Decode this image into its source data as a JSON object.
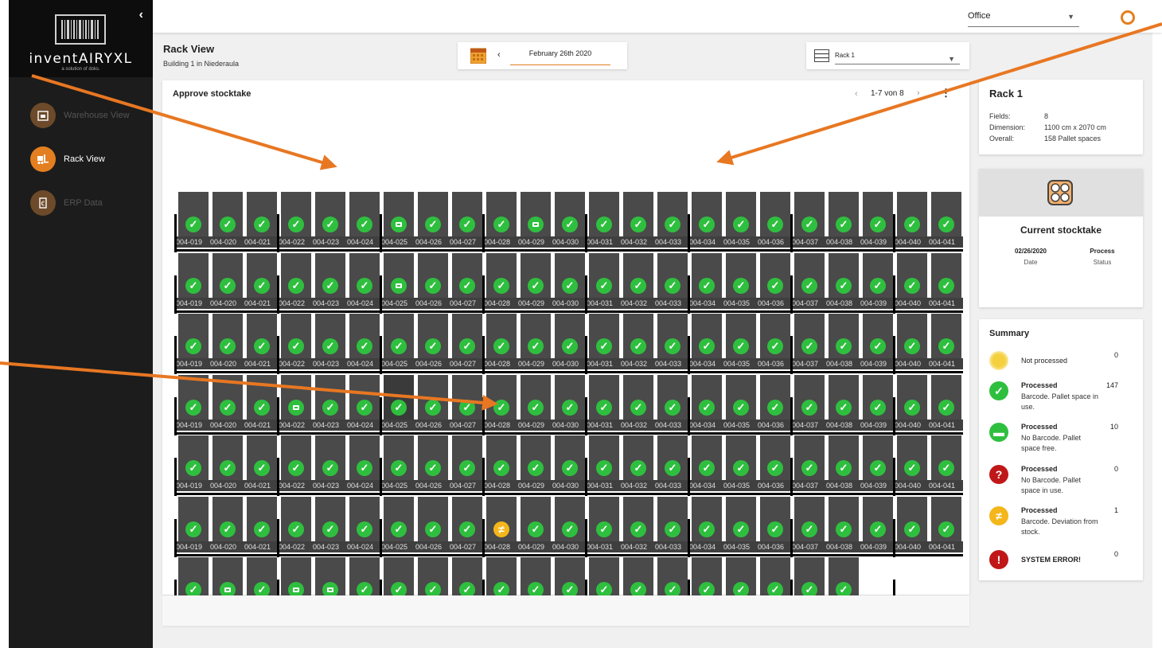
{
  "brand": {
    "name": "inventAIRYXL",
    "tagline": "a solution of doks."
  },
  "sidebar": {
    "items": [
      {
        "label": "Warehouse View",
        "icon": "warehouse-icon",
        "active": false
      },
      {
        "label": "Rack View",
        "icon": "forklift-icon",
        "active": true
      },
      {
        "label": "ERP Data",
        "icon": "erp-document-icon",
        "active": false
      }
    ]
  },
  "topbar": {
    "office": "Office"
  },
  "header": {
    "title": "Rack View",
    "subtitle": "Building 1 in Niederaula",
    "date": "February 26th 2020",
    "rack": "Rack 1"
  },
  "grid_card": {
    "title": "Approve stocktake",
    "pager": "1-7 von 8"
  },
  "rack_info": {
    "title": "Rack 1",
    "rows": [
      {
        "label": "Fields:",
        "value": "8"
      },
      {
        "label": "Dimension:",
        "value": "1100 cm x 2070 cm"
      },
      {
        "label": "Overall:",
        "value": "158 Pallet spaces"
      }
    ]
  },
  "stocktake": {
    "title": "Current stocktake",
    "date_value": "02/26/2020",
    "date_label": "Date",
    "status_value": "Process",
    "status_label": "Status"
  },
  "summary": {
    "title": "Summary",
    "items": [
      {
        "label": "Not processed",
        "desc": "",
        "count": "0",
        "color": "#f4d03f",
        "icon": "sun-icon",
        "glyph": ""
      },
      {
        "label": "Processed",
        "desc": "Barcode. Pallet space in use.",
        "count": "147",
        "color": "#2fbf3f",
        "icon": "check-icon",
        "glyph": "✓"
      },
      {
        "label": "Processed",
        "desc": "No Barcode. Pallet space free.",
        "count": "10",
        "color": "#2fbf3f",
        "icon": "free-space-icon",
        "glyph": "▬"
      },
      {
        "label": "Processed",
        "desc": "No Barcode. Pallet space in use.",
        "count": "0",
        "color": "#c01818",
        "icon": "question-icon",
        "glyph": "?"
      },
      {
        "label": "Processed",
        "desc": "Barcode. Deviation from stock.",
        "count": "1",
        "color": "#f4b61a",
        "icon": "not-equal-icon",
        "glyph": "≠"
      },
      {
        "label": "SYSTEM ERROR!",
        "desc": "",
        "count": "0",
        "color": "#c01818",
        "icon": "error-icon",
        "glyph": "!"
      }
    ]
  },
  "rack_grid": {
    "slot_labels": [
      "004-019",
      "004-020",
      "004-021",
      "004-022",
      "004-023",
      "004-024",
      "004-025",
      "004-026",
      "004-027",
      "004-028",
      "004-029",
      "004-030",
      "004-031",
      "004-032",
      "004-033",
      "004-034",
      "004-035",
      "004-036",
      "004-037",
      "004-038",
      "004-039",
      "004-040",
      "004-041"
    ],
    "rows": [
      "ccccccfcccfcccccccccccc",
      "ccccccfcccccccccccccccc",
      "ccccccccccccccccccccccc",
      "cccfccccccccccccccccccc",
      "ccccccccccccccccccccccc",
      "cccccccccdccccccccccccc",
      "cfcffcccccccccccccccxxx"
    ],
    "status_legend": {
      "c": "processed barcode in use",
      "f": "processed no barcode free",
      "d": "deviation from stock",
      "x": "empty"
    }
  },
  "colors": {
    "accent": "#e37f20",
    "green": "#2fbf3f",
    "yellow": "#f4b61a",
    "red": "#c01818",
    "sidebar": "#1c1c1c"
  }
}
